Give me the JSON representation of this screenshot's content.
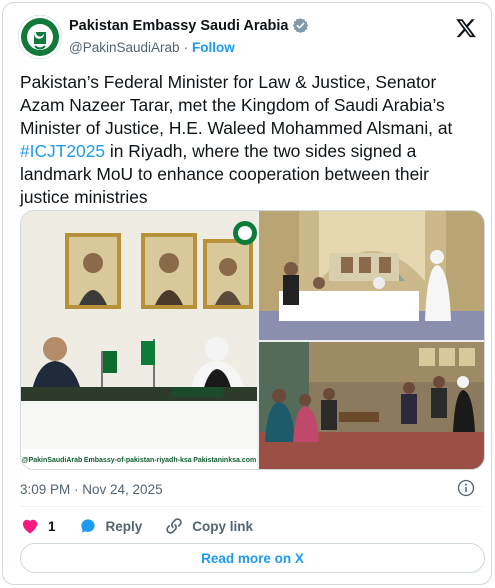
{
  "author": {
    "name": "Pakistan Embassy Saudi Arabia",
    "handle": "@PakinSaudiArab",
    "separator": "·",
    "follow_label": "Follow"
  },
  "tweet": {
    "text_before": "Pakistan’s Federal Minister for Law & Justice, Senator Azam Nazeer Tarar, met the Kingdom of Saudi Arabia’s Minister of Justice, H.E. Waleed Mohammed Alsmani, at ",
    "hashtag": "#ICJT2025",
    "text_after": " in Riyadh, where the two sides signed a landmark MoU to enhance cooperation between their justice ministries"
  },
  "media": {
    "footer_left": "@PakinSaudiArab",
    "footer_mid": "Embassy-of-pakistan-riyadh-ksa",
    "footer_right": "Pakistaninksa.com"
  },
  "meta": {
    "timestamp": "3:09 PM · Nov 24, 2025"
  },
  "actions": {
    "like_count": "1",
    "reply_label": "Reply",
    "copy_link_label": "Copy link"
  },
  "read_more_label": "Read more on X",
  "colors": {
    "accent": "#1d9bf0",
    "like": "#f91880",
    "muted": "#536471",
    "text": "#0f1419"
  },
  "icons": {
    "platform": "x-logo-icon",
    "verified": "verified-badge-icon",
    "info": "info-icon",
    "like": "heart-icon",
    "reply": "reply-bubble-icon",
    "copy_link": "link-icon"
  }
}
